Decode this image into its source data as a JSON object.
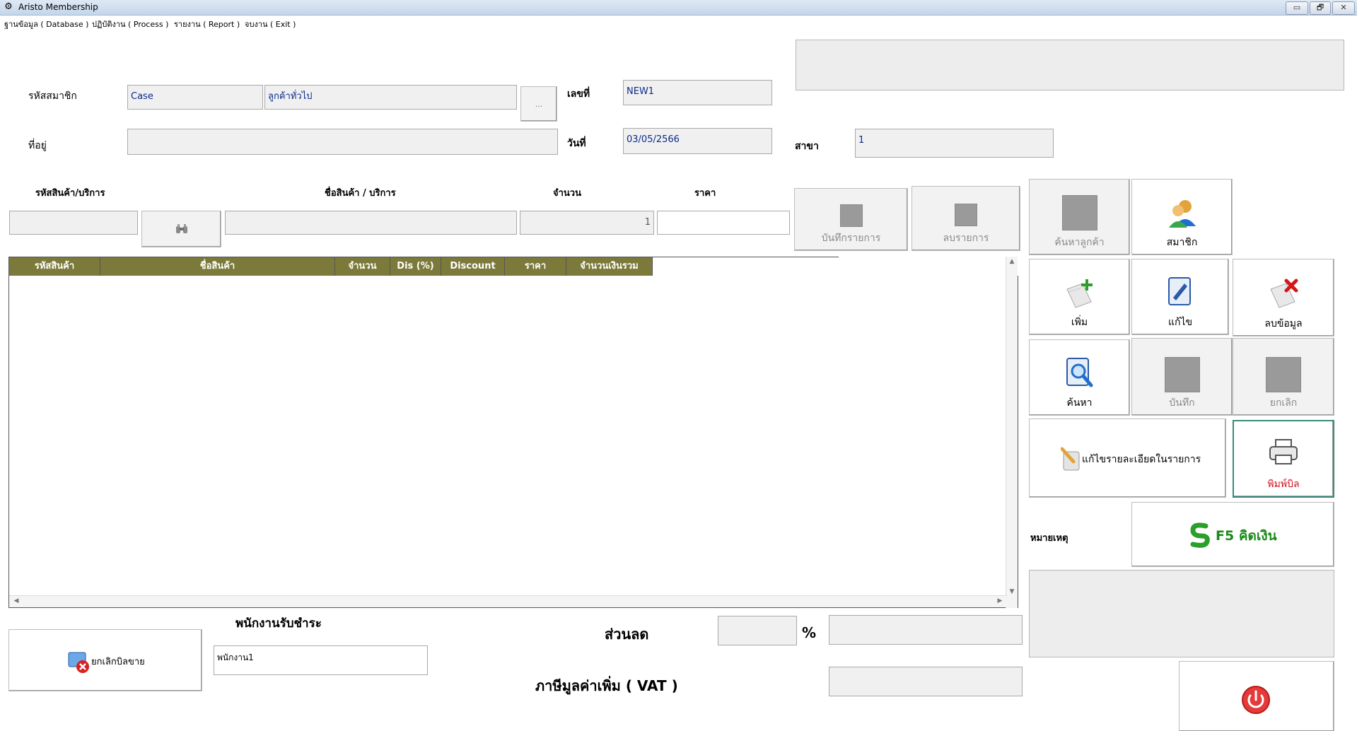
{
  "window": {
    "title": "Aristo Membership",
    "icon": "app-logo-icon",
    "controls": {
      "minimize": "▭",
      "restore": "🗗",
      "close": "✕"
    }
  },
  "menu": [
    "ฐานข้อมูล ( Database )",
    "ปฏิบัติงาน ( Process )",
    "รายงาน ( Report )",
    "จบงาน ( Exit )"
  ],
  "header": {
    "member_code_label": "รหัสสมาชิก",
    "member_code_value": "Case",
    "member_name_value": "ลูกค้าทั่วไป",
    "browse_label": "...",
    "doc_no_label": "เลขที่",
    "doc_no_value": "NEW1",
    "address_label": "ที่อยู่",
    "address_value": "",
    "date_label": "วันที่",
    "date_value": "03/05/2566",
    "branch_label": "สาขา",
    "branch_value": "1"
  },
  "entry": {
    "code_label": "รหัสสินค้า/บริการ",
    "name_label": "ชื่อสินค้า / บริการ",
    "qty_label": "จำนวน",
    "price_label": "ราคา",
    "code_value": "",
    "name_value": "",
    "qty_value": "1",
    "price_value": "",
    "save_item": "บันทึกรายการ",
    "delete_item": "ลบรายการ"
  },
  "grid": {
    "columns": [
      "รหัสสินค้า",
      "ชื่อสินค้า",
      "จำนวน",
      "Dis (%)",
      "Discount",
      "ราคา",
      "จำนวนเงินรวม"
    ],
    "rows": []
  },
  "actions": {
    "search_customer": "ค้นหาลูกค้า",
    "member": "สมาชิก",
    "add": "เพิ่ม",
    "edit": "แก้ไข",
    "delete": "ลบข้อมูล",
    "search": "ค้นหา",
    "save": "บันทึก",
    "cancel": "ยกเลิก",
    "edit_details": "แก้ไขรายละเอียดในรายการ",
    "print_bill": "พิมพ์บิล",
    "note_label": "หมายเหตุ",
    "checkout": "F5  คิดเงิน"
  },
  "footer": {
    "cashier_label": "พนักงานรับชำระ",
    "cashier_value": "พนักงาน1",
    "cancel_sale": "ยกเลิกบิลขาย",
    "discount_label": "ส่วนลด",
    "percent_sign": "%",
    "vat_label": "ภาษีมูลค่าเพิ่ม ( VAT )"
  },
  "colors": {
    "grid_header": "#7c7a3a",
    "print_text": "#d0101c",
    "checkout_text": "#1a8a1a",
    "field_text": "#0a2a8a"
  }
}
